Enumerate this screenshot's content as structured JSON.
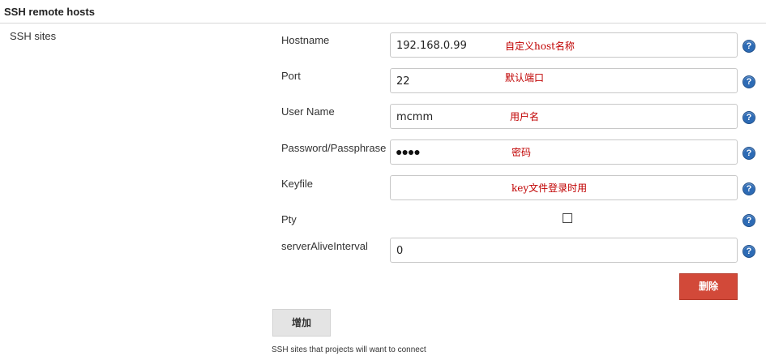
{
  "section": {
    "title": "SSH remote hosts"
  },
  "sites_label": "SSH sites",
  "fields": {
    "hostname": {
      "label": "Hostname",
      "value": "192.168.0.99",
      "annotation": "自定义host名称"
    },
    "port": {
      "label": "Port",
      "value": "22",
      "annotation": "默认端口"
    },
    "username": {
      "label": "User Name",
      "value": "mcmm",
      "annotation": "用户名"
    },
    "password": {
      "label": "Password/Passphrase",
      "value": "●●●●",
      "annotation": "密码"
    },
    "keyfile": {
      "label": "Keyfile",
      "value": "",
      "annotation": "key文件登录时用"
    },
    "pty": {
      "label": "Pty",
      "checked": false
    },
    "server_alive": {
      "label": "serverAliveInterval",
      "value": "0"
    }
  },
  "help_icon_text": "?",
  "buttons": {
    "delete_label": "删除",
    "add_label": "增加"
  },
  "description": "SSH sites that projects will want to connect",
  "colors": {
    "delete_bg": "#d24939",
    "help_icon": "#2d6bb5",
    "annotation": "#c00000"
  },
  "icons": {
    "help": "help-question-icon"
  }
}
